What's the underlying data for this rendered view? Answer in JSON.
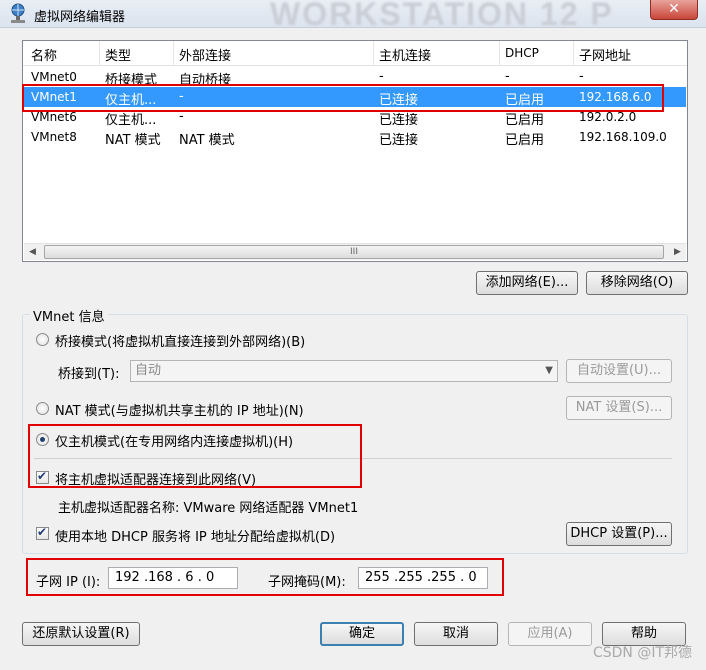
{
  "window": {
    "title": "虚拟网络编辑器",
    "watermark": "WORKSTATION 12 P",
    "close_label": "✕"
  },
  "list": {
    "columns": [
      "名称",
      "类型",
      "外部连接",
      "主机连接",
      "DHCP",
      "子网地址"
    ],
    "rows": [
      {
        "name": "VMnet0",
        "type": "桥接模式",
        "external": "自动桥接",
        "host": "-",
        "dhcp": "-",
        "subnet": "-"
      },
      {
        "name": "VMnet1",
        "type": "仅主机...",
        "external": "-",
        "host": "已连接",
        "dhcp": "已启用",
        "subnet": "192.168.6.0"
      },
      {
        "name": "VMnet6",
        "type": "仅主机...",
        "external": "-",
        "host": "已连接",
        "dhcp": "已启用",
        "subnet": "192.0.2.0"
      },
      {
        "name": "VMnet8",
        "type": "NAT 模式",
        "external": "NAT 模式",
        "host": "已连接",
        "dhcp": "已启用",
        "subnet": "192.168.109.0"
      }
    ],
    "selected_index": 1,
    "scroll_left": "◀",
    "scroll_right": "▶",
    "scroll_grip": "III"
  },
  "buttons": {
    "add_network": "添加网络(E)...",
    "remove_network": "移除网络(O)",
    "auto_settings": "自动设置(U)...",
    "nat_settings": "NAT 设置(S)...",
    "dhcp_settings": "DHCP 设置(P)...",
    "restore_defaults": "还原默认设置(R)",
    "ok": "确定",
    "cancel": "取消",
    "apply": "应用(A)",
    "help": "帮助"
  },
  "vmnet_info": {
    "group_label": "VMnet 信息",
    "bridged_label": "桥接模式(将虚拟机直接连接到外部网络)(B)",
    "bridged_to_label": "桥接到(T):",
    "bridged_to_value": "自动",
    "nat_label": "NAT 模式(与虚拟机共享主机的 IP 地址)(N)",
    "hostonly_label": "仅主机模式(在专用网络内连接虚拟机)(H)",
    "connect_adapter_label": "将主机虚拟适配器连接到此网络(V)",
    "adapter_name_text": "主机虚拟适配器名称: VMware 网络适配器 VMnet1",
    "use_dhcp_label": "使用本地 DHCP 服务将 IP 地址分配给虚拟机(D)",
    "subnet_ip_label": "子网 IP (I):",
    "subnet_ip_value": "192 .168 . 6  . 0",
    "subnet_mask_label": "子网掩码(M):",
    "subnet_mask_value": "255 .255 .255 . 0"
  },
  "footer": {
    "watermark_text": "CSDN @IT邦德"
  }
}
